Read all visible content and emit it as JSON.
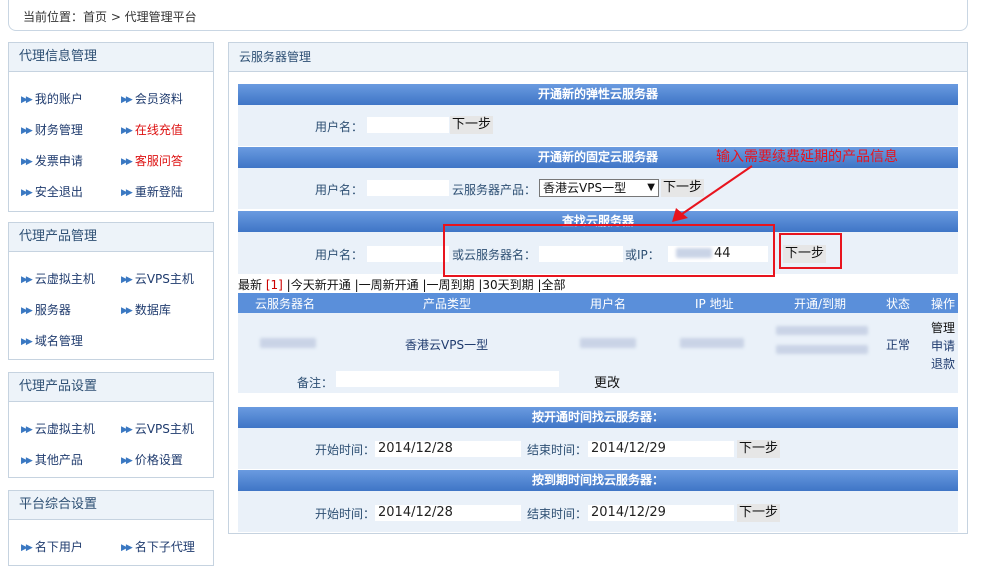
{
  "breadcrumb": {
    "text": "当前位置：首页 > 代理管理平台"
  },
  "sidebar": {
    "panels": [
      {
        "title": "代理信息管理",
        "items": [
          {
            "label": "我的账户"
          },
          {
            "label": "会员资料"
          },
          {
            "label": "财务管理"
          },
          {
            "label": "在线充值"
          },
          {
            "label": "发票申请"
          },
          {
            "label": "客服问答"
          },
          {
            "label": "安全退出"
          },
          {
            "label": "重新登陆"
          }
        ]
      },
      {
        "title": "代理产品管理",
        "items": [
          {
            "label": "云虚拟主机"
          },
          {
            "label": "云VPS主机"
          },
          {
            "label": "服务器"
          },
          {
            "label": "数据库"
          },
          {
            "label": "域名管理"
          }
        ]
      },
      {
        "title": "代理产品设置",
        "items": [
          {
            "label": "云虚拟主机"
          },
          {
            "label": "云VPS主机"
          },
          {
            "label": "其他产品"
          },
          {
            "label": "价格设置"
          }
        ]
      },
      {
        "title": "平台综合设置",
        "items": [
          {
            "label": "名下用户"
          },
          {
            "label": "名下子代理"
          }
        ]
      }
    ]
  },
  "main": {
    "title": "云服务器管理",
    "sec1": {
      "title": "开通新的弹性云服务器",
      "user_label": "用户名：",
      "next": "下一步"
    },
    "sec2": {
      "title": "开通新的固定云服务器",
      "user_label": "用户名：",
      "product_label": "云服务器产品：",
      "product_value": "香港云VPS一型",
      "next": "下一步"
    },
    "sec3": {
      "title": "查找云服务器",
      "user_label": "用户名：",
      "name_label": "或云服务器名：",
      "ip_label": "或IP：",
      "ip_value": "44",
      "next": "下一步"
    },
    "annotation": "输入需要续费延期的产品信息",
    "filters": {
      "latest": "最新",
      "count": "[1]",
      "today": "今天新开通",
      "week_new": "一周新开通",
      "week_due": "一周到期",
      "month_due": "30天到期",
      "all": "全部",
      "sep": "|"
    },
    "table": {
      "headers": [
        "云服务器名",
        "产品类型",
        "用户名",
        "IP 地址",
        "开通/到期",
        "状态",
        "操作"
      ],
      "row": {
        "product": "香港云VPS一型",
        "status": "正常",
        "actions": [
          "管理",
          "申请",
          "退款"
        ]
      },
      "note_label": "备注：",
      "change": "更改"
    },
    "sec4": {
      "title": "按开通时间找云服务器：",
      "start_label": "开始时间：",
      "start": "2014/12/28",
      "end_label": "结束时间：",
      "end": "2014/12/29",
      "next": "下一步"
    },
    "sec5": {
      "title": "按到期时间找云服务器：",
      "start_label": "开始时间：",
      "start": "2014/12/28",
      "end_label": "结束时间：",
      "end": "2014/12/29",
      "next": "下一步"
    }
  },
  "colors": {
    "header_blue": "#3f75c6",
    "row_bg": "#eaf1f9",
    "highlight_red": "#e8141e"
  }
}
